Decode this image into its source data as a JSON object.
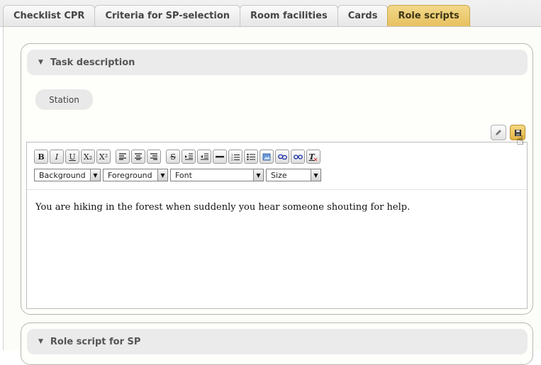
{
  "tabs": [
    {
      "label": "Checklist CPR",
      "active": false
    },
    {
      "label": "Criteria for SP-selection",
      "active": false
    },
    {
      "label": "Room facilities",
      "active": false
    },
    {
      "label": "Cards",
      "active": false
    },
    {
      "label": "Role scripts",
      "active": true
    }
  ],
  "task_section": {
    "title": "Task description",
    "station_label": "Station",
    "edit_icon": "pencil-icon",
    "save_icon": "floppy-disk-icon"
  },
  "editor": {
    "toolbar": {
      "bold": "B",
      "italic": "I",
      "underline": "U",
      "subscript": "X₂",
      "superscript": "X²",
      "strike": "S",
      "remove_format": "T"
    },
    "selects": {
      "background": "Background",
      "foreground": "Foreground",
      "font": "Font",
      "size": "Size"
    },
    "content": "You are hiking in the forest when suddenly you hear someone shouting for help."
  },
  "role_section": {
    "title": "Role script for SP"
  },
  "colors": {
    "active_tab": "#e7c060",
    "section_header": "#ebebeb"
  }
}
